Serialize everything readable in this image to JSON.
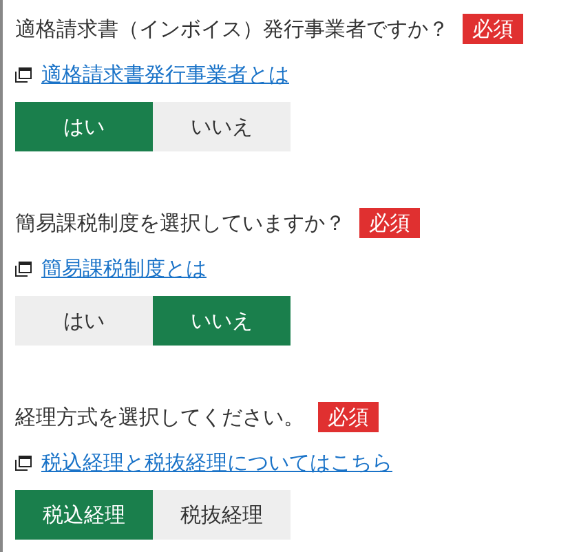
{
  "questions": [
    {
      "question": "適格請求書（インボイス）発行事業者ですか？",
      "badge": "必須",
      "link": "適格請求書発行事業者とは",
      "options": [
        {
          "label": "はい",
          "selected": true
        },
        {
          "label": "いいえ",
          "selected": false
        }
      ]
    },
    {
      "question": "簡易課税制度を選択していますか？",
      "badge": "必須",
      "link": "簡易課税制度とは",
      "options": [
        {
          "label": "はい",
          "selected": false
        },
        {
          "label": "いいえ",
          "selected": true
        }
      ]
    },
    {
      "question": "経理方式を選択してください。",
      "badge": "必須",
      "link": "税込経理と税抜経理についてはこちら",
      "options": [
        {
          "label": "税込経理",
          "selected": true
        },
        {
          "label": "税抜経理",
          "selected": false
        }
      ]
    }
  ]
}
